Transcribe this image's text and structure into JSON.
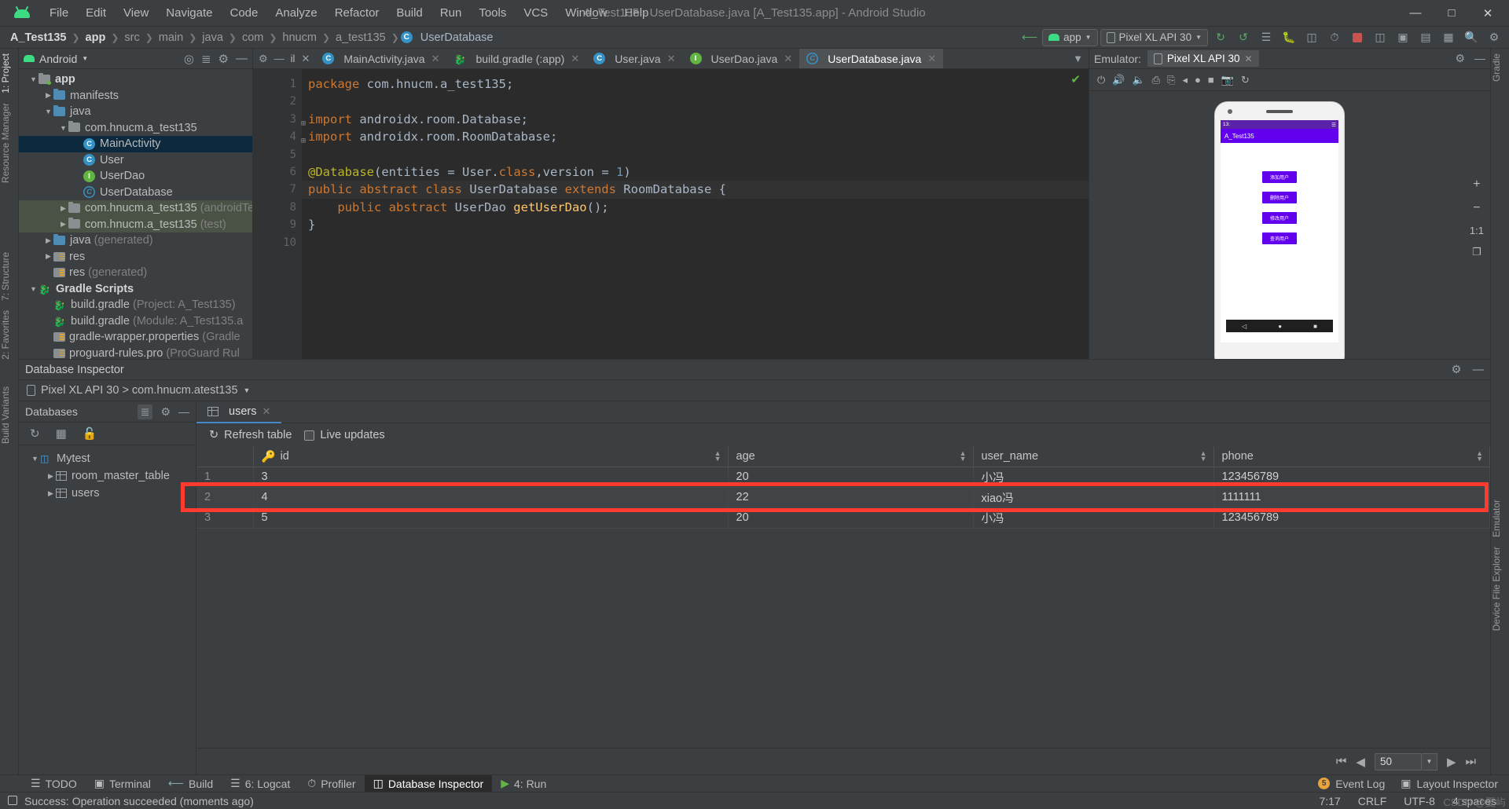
{
  "titlebar": {
    "logo_icon": "android-logo",
    "menus": [
      "File",
      "Edit",
      "View",
      "Navigate",
      "Code",
      "Analyze",
      "Refactor",
      "Build",
      "Run",
      "Tools",
      "VCS",
      "Window",
      "Help"
    ],
    "window_title": "A_Test135 - UserDatabase.java [A_Test135.app] - Android Studio",
    "minimize": "—",
    "maximize": "□",
    "close": "✕"
  },
  "navbar": {
    "breadcrumbs": [
      "A_Test135",
      "app",
      "src",
      "main",
      "java",
      "com",
      "hnucm",
      "a_test135",
      "UserDatabase"
    ],
    "run_config": "app",
    "device": "Pixel XL API 30",
    "icons": [
      "make-project-icon",
      "run-icon",
      "debug-icon",
      "apply-changes-icon",
      "attach-debugger-icon",
      "profiler-icon",
      "stop-icon",
      "avd-manager-icon",
      "sdk-manager-icon",
      "layout-inspector-icon",
      "sync-gradle-icon",
      "search-icon",
      "settings-icon"
    ]
  },
  "left_strips": [
    "1: Project",
    "Resource Manager",
    "7: Structure",
    "2: Favorites",
    "Build Variants"
  ],
  "right_strips": [
    "Gradle",
    "Emulator",
    "Device File Explorer"
  ],
  "project": {
    "title": "Android",
    "header_icons": [
      "locate-icon",
      "collapse-all-icon",
      "settings-icon",
      "minimize-icon"
    ],
    "tree": [
      {
        "indent": 0,
        "arrow": "down",
        "icon": "folder-module",
        "label": "app",
        "bold": true
      },
      {
        "indent": 1,
        "arrow": "right",
        "icon": "folder",
        "label": "manifests"
      },
      {
        "indent": 1,
        "arrow": "down",
        "icon": "folder",
        "label": "java"
      },
      {
        "indent": 2,
        "arrow": "down",
        "icon": "folder-pkg",
        "label": "com.hnucm.a_test135"
      },
      {
        "indent": 3,
        "arrow": "none",
        "icon": "class-c",
        "label": "MainActivity",
        "selected": true
      },
      {
        "indent": 3,
        "arrow": "none",
        "icon": "class-c",
        "label": "User"
      },
      {
        "indent": 3,
        "arrow": "none",
        "icon": "interface-i",
        "label": "UserDao"
      },
      {
        "indent": 3,
        "arrow": "none",
        "icon": "class-abstract",
        "label": "UserDatabase"
      },
      {
        "indent": 2,
        "arrow": "right",
        "icon": "folder-pkg",
        "label": "com.hnucm.a_test135",
        "suffix": "(androidTest)",
        "testsrc": true
      },
      {
        "indent": 2,
        "arrow": "right",
        "icon": "folder-pkg",
        "label": "com.hnucm.a_test135",
        "suffix": "(test)",
        "testsrc": true
      },
      {
        "indent": 1,
        "arrow": "right",
        "icon": "folder-gen",
        "label": "java",
        "suffix": "(generated)"
      },
      {
        "indent": 1,
        "arrow": "right",
        "icon": "folder-res",
        "label": "res"
      },
      {
        "indent": 1,
        "arrow": "none",
        "icon": "folder-res",
        "label": "res",
        "suffix": "(generated)"
      },
      {
        "indent": 0,
        "arrow": "down",
        "icon": "gradle",
        "label": "Gradle Scripts",
        "bold": true
      },
      {
        "indent": 1,
        "arrow": "none",
        "icon": "gradle",
        "label": "build.gradle",
        "suffix": "(Project: A_Test135)"
      },
      {
        "indent": 1,
        "arrow": "none",
        "icon": "gradle",
        "label": "build.gradle",
        "suffix": "(Module: A_Test135.a"
      },
      {
        "indent": 1,
        "arrow": "none",
        "icon": "properties",
        "label": "gradle-wrapper.properties",
        "suffix": "(Gradle"
      },
      {
        "indent": 1,
        "arrow": "none",
        "icon": "properties",
        "label": "proguard-rules.pro",
        "suffix": "(ProGuard Rul"
      }
    ]
  },
  "editor": {
    "tabs": [
      {
        "label": "MainActivity.java",
        "icon": "class-c",
        "active": false
      },
      {
        "label": "build.gradle (:app)",
        "icon": "gradle",
        "active": false
      },
      {
        "label": "User.java",
        "icon": "class-c",
        "active": false
      },
      {
        "label": "UserDao.java",
        "icon": "interface-i",
        "active": false
      },
      {
        "label": "UserDatabase.java",
        "icon": "class-abstract",
        "active": true
      }
    ],
    "gutter_numbers": [
      "1",
      "2",
      "3",
      "4",
      "5",
      "6",
      "7",
      "8",
      "9",
      "10"
    ],
    "lines": [
      [
        {
          "t": "package ",
          "c": "kw"
        },
        {
          "t": "com.hnucm.a_test135;",
          "c": "txt"
        }
      ],
      [],
      [
        {
          "t": "import ",
          "c": "kw"
        },
        {
          "t": "androidx.room.",
          "c": "txt"
        },
        {
          "t": "Database",
          "c": "txt"
        },
        {
          "t": ";",
          "c": "txt"
        }
      ],
      [
        {
          "t": "import ",
          "c": "kw"
        },
        {
          "t": "androidx.room.",
          "c": "txt"
        },
        {
          "t": "RoomDatabase",
          "c": "txt"
        },
        {
          "t": ";",
          "c": "txt"
        }
      ],
      [],
      [
        {
          "t": "@Database",
          "c": "ann"
        },
        {
          "t": "(entities = ",
          "c": "txt"
        },
        {
          "t": "User",
          "c": "txt"
        },
        {
          "t": ".",
          "c": "txt"
        },
        {
          "t": "class",
          "c": "kw"
        },
        {
          "t": ",version = ",
          "c": "txt"
        },
        {
          "t": "1",
          "c": "num"
        },
        {
          "t": ")",
          "c": "txt"
        }
      ],
      [
        {
          "t": "public abstract class ",
          "c": "kw"
        },
        {
          "t": "UserDatabase ",
          "c": "txt"
        },
        {
          "t": "extends ",
          "c": "kw"
        },
        {
          "t": "RoomDatabase {",
          "c": "txt"
        }
      ],
      [
        {
          "t": "    public abstract ",
          "c": "kw"
        },
        {
          "t": "UserDao ",
          "c": "txt"
        },
        {
          "t": "getUserDao",
          "c": "fn"
        },
        {
          "t": "();",
          "c": "txt"
        }
      ],
      [
        {
          "t": "}",
          "c": "txt"
        }
      ],
      []
    ],
    "status_check": "✔"
  },
  "emulator": {
    "label": "Emulator:",
    "tab": "Pixel XL API 30",
    "toolbar_icons": [
      "power-icon",
      "volume-up-icon",
      "volume-down-icon",
      "rotate-left-icon",
      "rotate-right-icon",
      "back-icon",
      "home-icon",
      "overview-icon",
      "screenshot-icon",
      "snapshot-icon"
    ],
    "side_controls": [
      "+",
      "−",
      "1:1",
      "❐"
    ],
    "device": {
      "status_time": "13:",
      "app_title": "A_Test135",
      "buttons": [
        "添加用户",
        "删除用户",
        "修改用户",
        "查询用户"
      ],
      "nav": [
        "◁",
        "●",
        "■"
      ]
    }
  },
  "database_inspector": {
    "title": "Database Inspector",
    "device_process": "Pixel XL API 30 > com.hnucm.atest135",
    "databases_panel": {
      "title": "Databases",
      "toolbar_icons": [
        "refresh-icon",
        "run-query-icon",
        "keep-connection-icon"
      ],
      "tree": [
        {
          "indent": 0,
          "arrow": "down",
          "icon": "database-icon",
          "label": "Mytest"
        },
        {
          "indent": 1,
          "arrow": "right",
          "icon": "table-icon",
          "label": "room_master_table"
        },
        {
          "indent": 1,
          "arrow": "right",
          "icon": "table-icon",
          "label": "users"
        }
      ]
    },
    "table_tab": "users",
    "refresh_label": "Refresh table",
    "live_updates_label": "Live updates",
    "columns": [
      "",
      "id",
      "age",
      "user_name",
      "phone"
    ],
    "rows": [
      {
        "n": "1",
        "id": "3",
        "age": "20",
        "user_name": "小冯",
        "phone": "123456789"
      },
      {
        "n": "2",
        "id": "4",
        "age": "22",
        "user_name": "xiao冯",
        "phone": "1111111",
        "highlighted": true
      },
      {
        "n": "3",
        "id": "5",
        "age": "20",
        "user_name": "小冯",
        "phone": "123456789"
      }
    ],
    "page_size": "50",
    "pager_icons": [
      "first-page-icon",
      "prev-page-icon",
      "next-page-icon",
      "last-page-icon"
    ]
  },
  "bottombar": {
    "items": [
      {
        "label": "TODO",
        "icon": "todo-icon",
        "active": false
      },
      {
        "label": "Terminal",
        "icon": "terminal-icon",
        "active": false
      },
      {
        "label": "Build",
        "icon": "build-icon",
        "active": false
      },
      {
        "label": "6: Logcat",
        "icon": "logcat-icon",
        "active": false
      },
      {
        "label": "Profiler",
        "icon": "profiler-icon",
        "active": false
      },
      {
        "label": "Database Inspector",
        "icon": "database-icon",
        "active": true
      },
      {
        "label": "4: Run",
        "icon": "run-icon",
        "active": false
      }
    ],
    "event_log": "Event Log",
    "event_count": "5",
    "layout_inspector": "Layout Inspector"
  },
  "statusbar": {
    "message": "Success: Operation succeeded (moments ago)",
    "caret": "7:17",
    "line_sep": "CRLF",
    "encoding": "UTF-8",
    "indent": "4 spaces",
    "watermark": "CSDN @夏屿"
  }
}
